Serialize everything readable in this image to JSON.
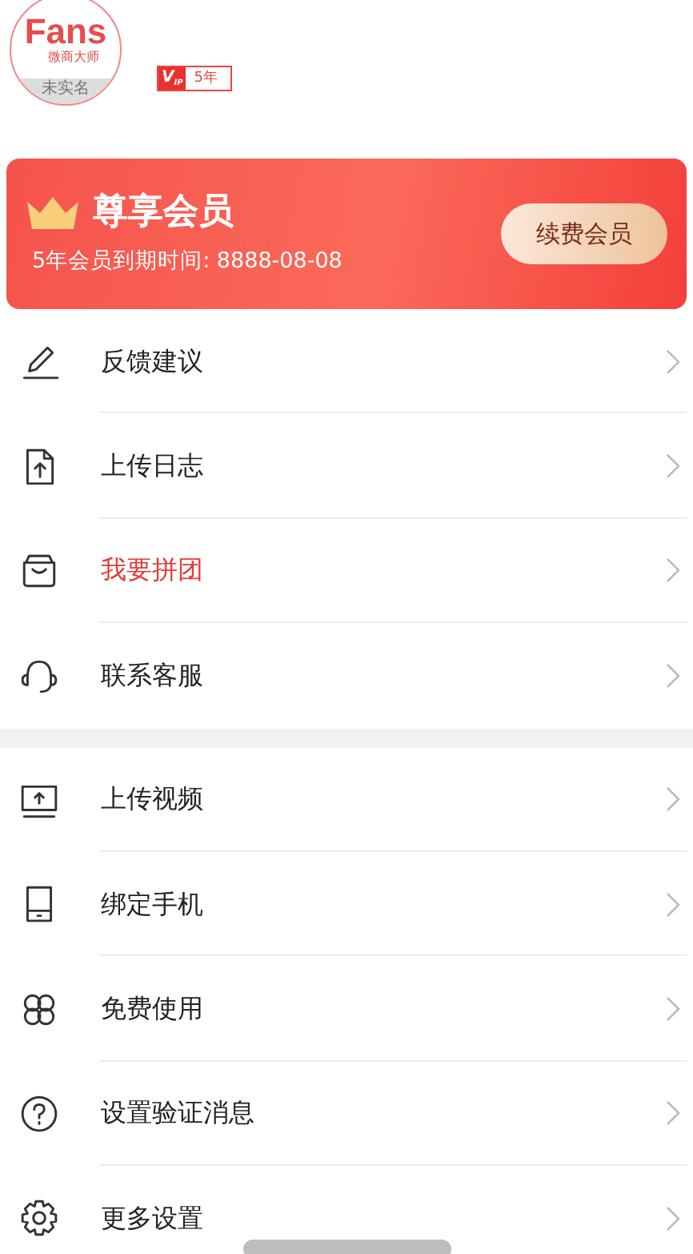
{
  "profile": {
    "logo_text": "Fans",
    "logo_subtitle": "微商大师",
    "verification": "未实名"
  },
  "vip_badge": {
    "mark": "V",
    "sub": "IP",
    "years": "5年"
  },
  "membership": {
    "title": "尊享会员",
    "expiry": "5年会员到期时间: 8888-08-08",
    "button": "续费会员"
  },
  "menu_groups": [
    {
      "items": [
        {
          "label": "反馈建议",
          "highlighted": false
        },
        {
          "label": "上传日志",
          "highlighted": false
        },
        {
          "label": "我要拼团",
          "highlighted": true
        },
        {
          "label": "联系客服",
          "highlighted": false
        }
      ]
    },
    {
      "items": [
        {
          "label": "上传视频",
          "highlighted": false
        },
        {
          "label": "绑定手机",
          "highlighted": false
        },
        {
          "label": "免费使用",
          "highlighted": false
        },
        {
          "label": "设置验证消息",
          "highlighted": false
        },
        {
          "label": "更多设置",
          "highlighted": false
        }
      ]
    }
  ]
}
